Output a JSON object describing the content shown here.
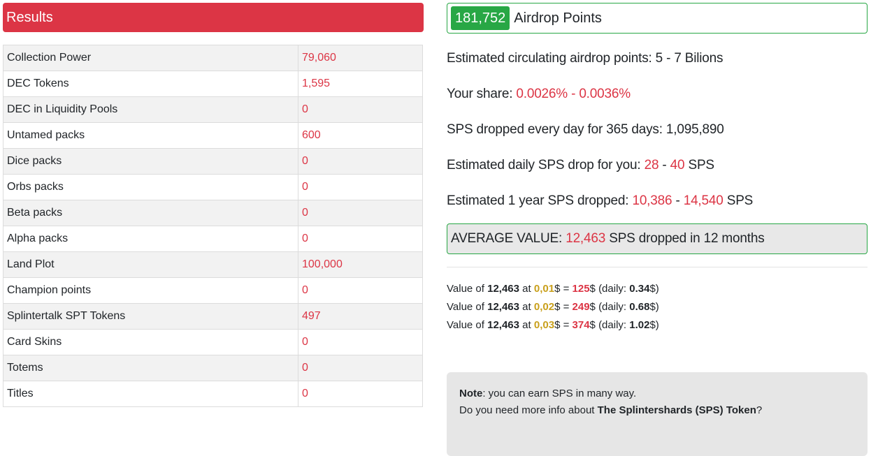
{
  "results": {
    "title": "Results",
    "rows": [
      {
        "label": "Collection Power",
        "value": "79,060"
      },
      {
        "label": "DEC Tokens",
        "value": "1,595"
      },
      {
        "label": "DEC in Liquidity Pools",
        "value": "0"
      },
      {
        "label": "Untamed packs",
        "value": "600"
      },
      {
        "label": "Dice packs",
        "value": "0"
      },
      {
        "label": "Orbs packs",
        "value": "0"
      },
      {
        "label": "Beta packs",
        "value": "0"
      },
      {
        "label": "Alpha packs",
        "value": "0"
      },
      {
        "label": "Land Plot",
        "value": "100,000"
      },
      {
        "label": "Champion points",
        "value": "0"
      },
      {
        "label": "Splintertalk SPT Tokens",
        "value": "497"
      },
      {
        "label": "Card Skins",
        "value": "0"
      },
      {
        "label": "Totems",
        "value": "0"
      },
      {
        "label": "Titles",
        "value": "0"
      }
    ]
  },
  "airdrop": {
    "points": "181,752",
    "label": "Airdrop Points"
  },
  "estimates": {
    "circulating": {
      "label": "Estimated circulating airdrop points:",
      "value": "5 - 7 Bilions"
    },
    "share": {
      "label": "Your share:",
      "min": "0.0026%",
      "separator": "-",
      "max": "0.0036%"
    },
    "daily_total": {
      "label": "SPS dropped every day for 365 days:",
      "value": "1,095,890"
    },
    "daily_user": {
      "label": "Estimated daily SPS drop for you:",
      "min": "28",
      "separator": "-",
      "max": "40",
      "unit": "SPS"
    },
    "yearly_user": {
      "label": "Estimated 1 year SPS dropped:",
      "min": "10,386",
      "separator": "-",
      "max": "14,540",
      "unit": "SPS"
    }
  },
  "average": {
    "label": "AVERAGE VALUE:",
    "value": "12,463",
    "suffix": "SPS dropped in 12 months"
  },
  "valuation_text": {
    "prefix": "Value of",
    "at": "at",
    "currency": "$",
    "equals": "=",
    "daily_open": "(daily:",
    "daily_close": "$)"
  },
  "valuations": [
    {
      "amount": "12,463",
      "price": "0,01",
      "total": "125",
      "daily": "0.34"
    },
    {
      "amount": "12,463",
      "price": "0,02",
      "total": "249",
      "daily": "0.68"
    },
    {
      "amount": "12,463",
      "price": "0,03",
      "total": "374",
      "daily": "1.02"
    }
  ],
  "note": {
    "title": "Note",
    "text": ": you can earn SPS in many way.",
    "info_prefix": "Do you need more info about",
    "info_topic": "The Splintershards (SPS) Token",
    "info_suffix": "?"
  },
  "colors": {
    "accent_red": "#dc3545",
    "success_green": "#28a745",
    "price_gold": "#c9a01c"
  }
}
